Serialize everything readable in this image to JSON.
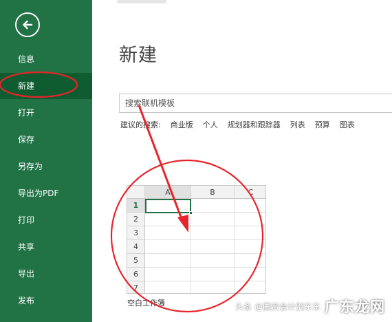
{
  "sidebar": {
    "items": [
      {
        "label": "信息"
      },
      {
        "label": "新建"
      },
      {
        "label": "打开"
      },
      {
        "label": "保存"
      },
      {
        "label": "另存为"
      },
      {
        "label": "导出为PDF"
      },
      {
        "label": "打印"
      },
      {
        "label": "共享"
      },
      {
        "label": "导出"
      },
      {
        "label": "发布"
      }
    ],
    "active_index": 1
  },
  "main": {
    "title": "新建",
    "search_placeholder": "搜索联机模板",
    "suggestions_label": "建议的搜索:",
    "suggestions": [
      "商业版",
      "个人",
      "规划器和跟踪器",
      "列表",
      "预算",
      "图表"
    ],
    "template": {
      "columns": [
        "A",
        "B",
        "C"
      ],
      "rows": [
        "1",
        "2",
        "3",
        "4",
        "5",
        "6",
        "7"
      ],
      "label": "空白工作簿"
    }
  },
  "watermark": {
    "text": "头条 @国资会计别东东",
    "site": "广东龙网"
  },
  "colors": {
    "sidebar": "#217346",
    "sidebar_active": "#0e5c2f",
    "annotation": "#e8232a"
  }
}
